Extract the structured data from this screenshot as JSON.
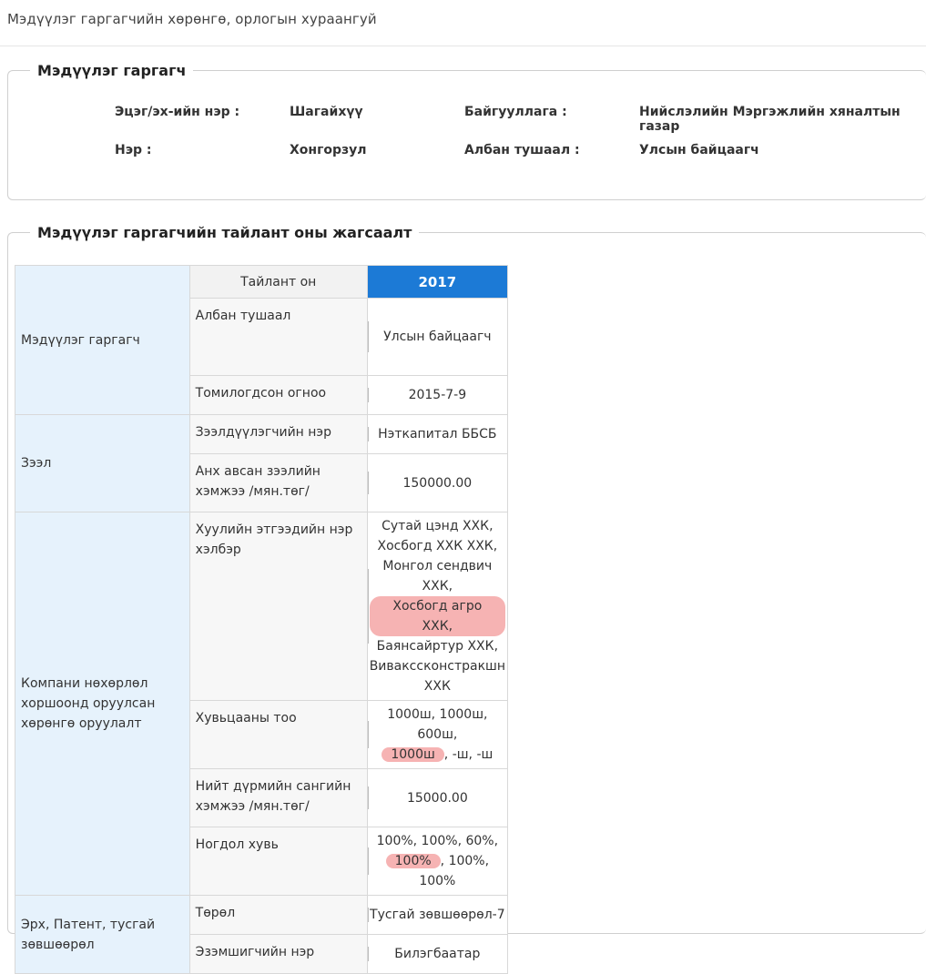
{
  "page": {
    "title": "Мэдүүлэг гаргагчийн хөрөнгө, орлогын хураангуй"
  },
  "declarant_section": {
    "legend": "Мэдүүлэг гаргагч",
    "surname_label": "Эцэг/эх-ийн нэр :",
    "surname_value": "Шагайхүү",
    "name_label": "Нэр :",
    "name_value": "Хонгорзул",
    "org_label": "Байгууллага :",
    "org_value": "Нийслэлийн Мэргэжлийн хяналтын газар",
    "position_label": "Албан тушаал :",
    "position_value": "Улсын байцаагч"
  },
  "summary_section": {
    "legend": "Мэдүүлэг гаргагчийн тайлант оны жагсаалт",
    "year_header": "Тайлант он",
    "year": "2017",
    "groups": {
      "declarant": "Мэдүүлэг гаргагч",
      "loan": "Зээл",
      "company": "Компани нөхөрлөл хоршоонд оруулсан хөрөнгө оруулалт",
      "rights": "Эрх, Патент, тусгай зөвшөөрөл"
    },
    "rows": {
      "position_label": "Албан тушаал",
      "position_value": "Улсын байцаагч",
      "appointed_label": "Томилогдсон огноо",
      "appointed_value": "2015-7-9",
      "lender_label": "Зээлдүүлэгчийн нэр",
      "lender_value": "Нэткапитал ББСБ",
      "loan_amount_label": "Анх авсан зээлийн хэмжээ /мян.төг/",
      "loan_amount_value": "150000.00",
      "entity_label": "Хуулийн этгээдийн нэр хэлбэр",
      "entity_lines": [
        "Сутай цэнд ХХК,",
        "Хосбогд ХХК ХХК,",
        "Монгол сендвич ХХК,",
        "Хосбогд агро ХХК,",
        "Баянсайртур ХХК,",
        "Вивакссконстракшн",
        "ХХК"
      ],
      "shares_label": "Хувьцааны тоо",
      "shares_line1": "1000ш, 1000ш, 600ш,",
      "shares_hl": "1000ш",
      "shares_rest": ", -ш, -ш",
      "capital_label": "Нийт дүрмийн сангийн хэмжээ /мян.төг/",
      "capital_value": "15000.00",
      "stake_label": "Ногдол хувь",
      "stake_line1": "100%, 100%, 60%,",
      "stake_hl": "100%",
      "stake_rest": ", 100%, 100%",
      "type_label": "Төрөл",
      "type_value": "Тусгай зөвшөөрөл-7",
      "owner_label": "Эзэмшигчийн нэр",
      "owner_value": "Билэгбаатар"
    }
  }
}
